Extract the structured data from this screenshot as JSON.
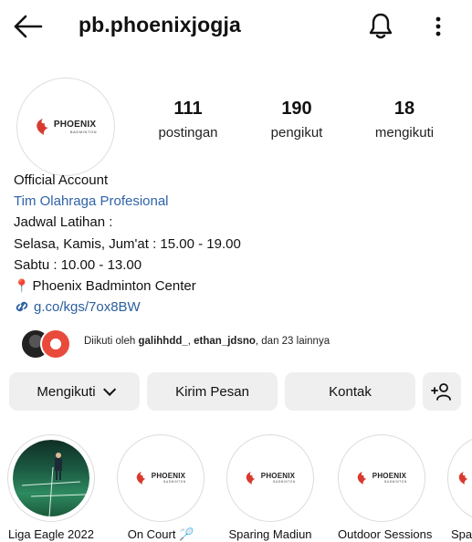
{
  "header": {
    "username": "pb.phoenixjogja"
  },
  "profile": {
    "logo": {
      "main": "PHOENIX",
      "sub": "BADMINTON"
    }
  },
  "stats": [
    {
      "value": "111",
      "label": "postingan"
    },
    {
      "value": "190",
      "label": "pengikut"
    },
    {
      "value": "18",
      "label": "mengikuti"
    }
  ],
  "bio": {
    "line1": "Official Account",
    "category": "Tim Olahraga Profesional",
    "line3": "Jadwal Latihan :",
    "line4": "Selasa, Kamis, Jum'at : 15.00 - 19.00",
    "line5": "Sabtu : 10.00 - 13.00",
    "location": "Phoenix Badminton Center",
    "link": "g.co/kgs/7ox8BW"
  },
  "followed_by": {
    "prefix": "Diikuti oleh ",
    "user1": "galihhdd_",
    "sep": ", ",
    "user2": "ethan_jdsno",
    "suffix": ", dan 23 lainnya"
  },
  "actions": {
    "following": "Mengikuti",
    "message": "Kirim Pesan",
    "contact": "Kontak"
  },
  "highlights": [
    {
      "label": "Liga Eagle 2022"
    },
    {
      "label": "On Court 🏸"
    },
    {
      "label": "Sparing Madiun"
    },
    {
      "label": "Outdoor Sessions"
    },
    {
      "label": "Spa"
    }
  ],
  "colors": {
    "link_blue": "#2b5f9e",
    "button_bg": "#efefef",
    "pin_red": "#e0342b"
  }
}
